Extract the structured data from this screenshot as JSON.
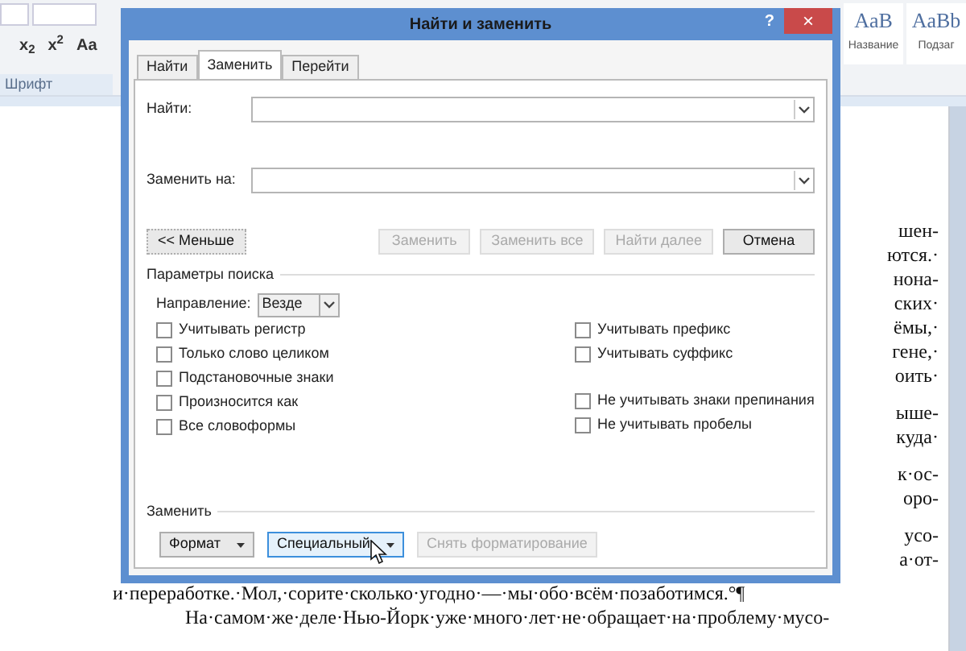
{
  "ribbon": {
    "font_tools": [
      "x$_{2}$",
      "x$^{2}$",
      "Aa"
    ],
    "group_label": "Шрифт",
    "styles": [
      {
        "sample": "AaB",
        "name": "Название"
      },
      {
        "sample": "AaBb",
        "name": "Подзаг"
      }
    ]
  },
  "document": {
    "paragraph_ends": [
      [
        "шен-",
        "ются.·",
        "нона-",
        "ских·",
        "ёмы,·",
        "гене,·",
        "оить·"
      ],
      [
        "ыше-",
        "куда·"
      ],
      [
        "к·ос-",
        "оро-"
      ],
      [
        "усо-",
        "а·от-"
      ]
    ],
    "lines": [
      {
        "text": "и·переработке.·Мол,·сорите·сколько·угодно·—·мы·обо·всём·позаботимся.°¶",
        "indent": false
      },
      {
        "text": "На·самом·же·деле·Нью-Йорк·уже·много·лет·не·обращает·на·проблему·мусо-",
        "indent": true
      }
    ]
  },
  "dialog": {
    "title": "Найти и заменить",
    "help": "?",
    "close": "×",
    "tabs": [
      {
        "label": "Найти",
        "selected": false
      },
      {
        "label": "Заменить",
        "selected": true
      },
      {
        "label": "Перейти",
        "selected": false
      }
    ],
    "find": {
      "label": "Найти:"
    },
    "replace": {
      "label": "Заменить на:"
    },
    "buttons": [
      {
        "label": "<< Меньше",
        "disabled": false,
        "kind": "toggle"
      },
      {
        "label": "Заменить",
        "disabled": true,
        "kind": "action"
      },
      {
        "label": "Заменить все",
        "disabled": true,
        "kind": "action"
      },
      {
        "label": "Найти далее",
        "disabled": true,
        "kind": "action"
      },
      {
        "label": "Отмена",
        "disabled": false,
        "kind": "action"
      }
    ],
    "search_options": {
      "title": "Параметры поиска",
      "direction": {
        "label": "Направление:",
        "value": "Везде"
      },
      "left": [
        {
          "label": "Учитывать регистр",
          "checked": false
        },
        {
          "label": "Только слово целиком",
          "checked": false
        },
        {
          "label": "Подстановочные знаки",
          "checked": false
        },
        {
          "label": "Произносится как",
          "checked": false
        },
        {
          "label": "Все словоформы",
          "checked": false
        }
      ],
      "right_groups": [
        [
          {
            "label": "Учитывать префикс",
            "checked": false
          },
          {
            "label": "Учитывать суффикс",
            "checked": false
          }
        ],
        [
          {
            "label": "Не учитывать знаки препинания",
            "checked": false
          },
          {
            "label": "Не учитывать пробелы",
            "checked": false
          }
        ]
      ]
    },
    "replace_section": {
      "title": "Заменить",
      "buttons": [
        {
          "label": "Формат",
          "disabled": false,
          "focused": false,
          "menu": true
        },
        {
          "label": "Специальный",
          "disabled": false,
          "focused": true,
          "menu": true
        },
        {
          "label": "Снять форматирование",
          "disabled": true,
          "focused": false,
          "menu": false
        }
      ]
    }
  }
}
